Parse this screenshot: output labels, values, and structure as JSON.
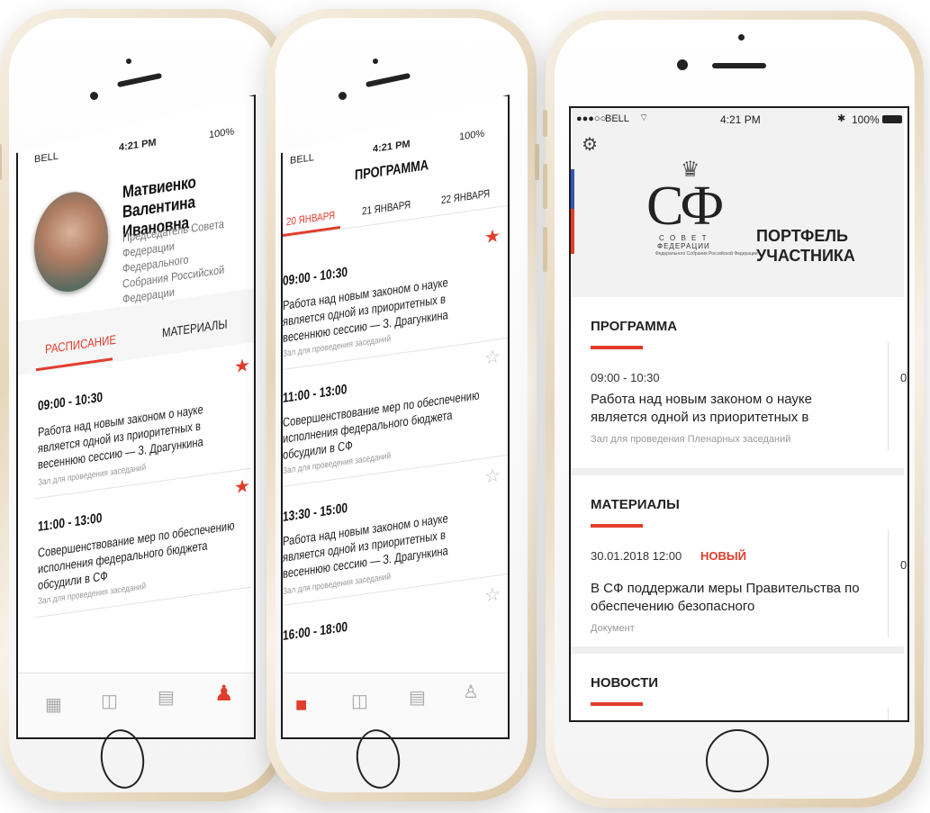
{
  "status": {
    "carrier": "BELL",
    "carrier3": "BELL",
    "time": "4:21 PM",
    "battery": "100%"
  },
  "phone1": {
    "name": "Матвиенко Валентина Ивановна",
    "role": "Председатель Совета Федерации Федерального Собрания Российской Федерации",
    "tabs": [
      {
        "label": "РАСПИСАНИЕ",
        "active": true
      },
      {
        "label": "МАТЕРИАЛЫ",
        "active": false
      }
    ],
    "events": [
      {
        "time": "09:00 - 10:30",
        "text": "Работа над новым законом о науке является одной из приоритетных в весеннюю сессию — З. Драгункина",
        "location": "Зал для проведения заседаний",
        "starred": true
      },
      {
        "time": "11:00 - 13:00",
        "text": "Совершенствование мер по обеспечению исполнения федерального бюджета обсудили в СФ",
        "location": "Зал для проведения заседаний",
        "starred": true
      }
    ],
    "tabbar": [
      "grid-icon",
      "map-icon",
      "chat-icon",
      "profile-icon"
    ],
    "active_tab": "profile-icon"
  },
  "phone2": {
    "title": "ПРОГРАММА",
    "days": [
      {
        "label": "20 ЯНВАРЯ",
        "active": true
      },
      {
        "label": "21 ЯНВАРЯ",
        "active": false
      },
      {
        "label": "22 ЯНВАРЯ",
        "active": false
      }
    ],
    "events": [
      {
        "time": "09:00 - 10:30",
        "text": "Работа над новым законом о науке является одной из приоритетных в весеннюю сессию — З. Драгункина",
        "location": "Зал для проведения заседаний",
        "starred": true
      },
      {
        "time": "11:00 - 13:00",
        "text": "Совершенствование мер по обеспечению исполнения федерального бюджета обсудили в СФ",
        "location": "Зал для проведения заседаний",
        "starred": false
      },
      {
        "time": "13:30 - 15:00",
        "text": "Работа над новым законом о науке является одной из приоритетных в весеннюю сессию — З. Драгункина",
        "location": "Зал для проведения заседаний",
        "starred": false
      },
      {
        "time": "16:00 - 18:00",
        "text": "",
        "location": "",
        "starred": false
      }
    ],
    "active_tab": "grid-icon"
  },
  "phone3": {
    "logo_letters": "СФ",
    "logo_sub": "С О В Е Т",
    "logo_sub2": "ФЕДЕРАЦИИ",
    "logo_sub3": "Федерального Собрания Российской Федерации",
    "app_title_1": "ПОРТФЕЛЬ",
    "app_title_2": "УЧАСТНИКА",
    "program": {
      "title": "ПРОГРАММА",
      "time": "09:00 - 10:30",
      "text": "Работа над новым законом о науке является одной из приоритетных в",
      "location": "Зал для проведения Пленарных заседаний",
      "peek": "0"
    },
    "materials": {
      "title": "МАТЕРИАЛЫ",
      "date": "30.01.2018 12:00",
      "badge": "НОВЫЙ",
      "text": "В СФ поддержали меры Правительства по обеспечению безопасного",
      "type": "Документ",
      "peek": "0"
    },
    "news": {
      "title": "НОВОСТИ"
    }
  },
  "colors": {
    "accent": "#e23c2c",
    "frame_gold": "#e6d6bb"
  }
}
